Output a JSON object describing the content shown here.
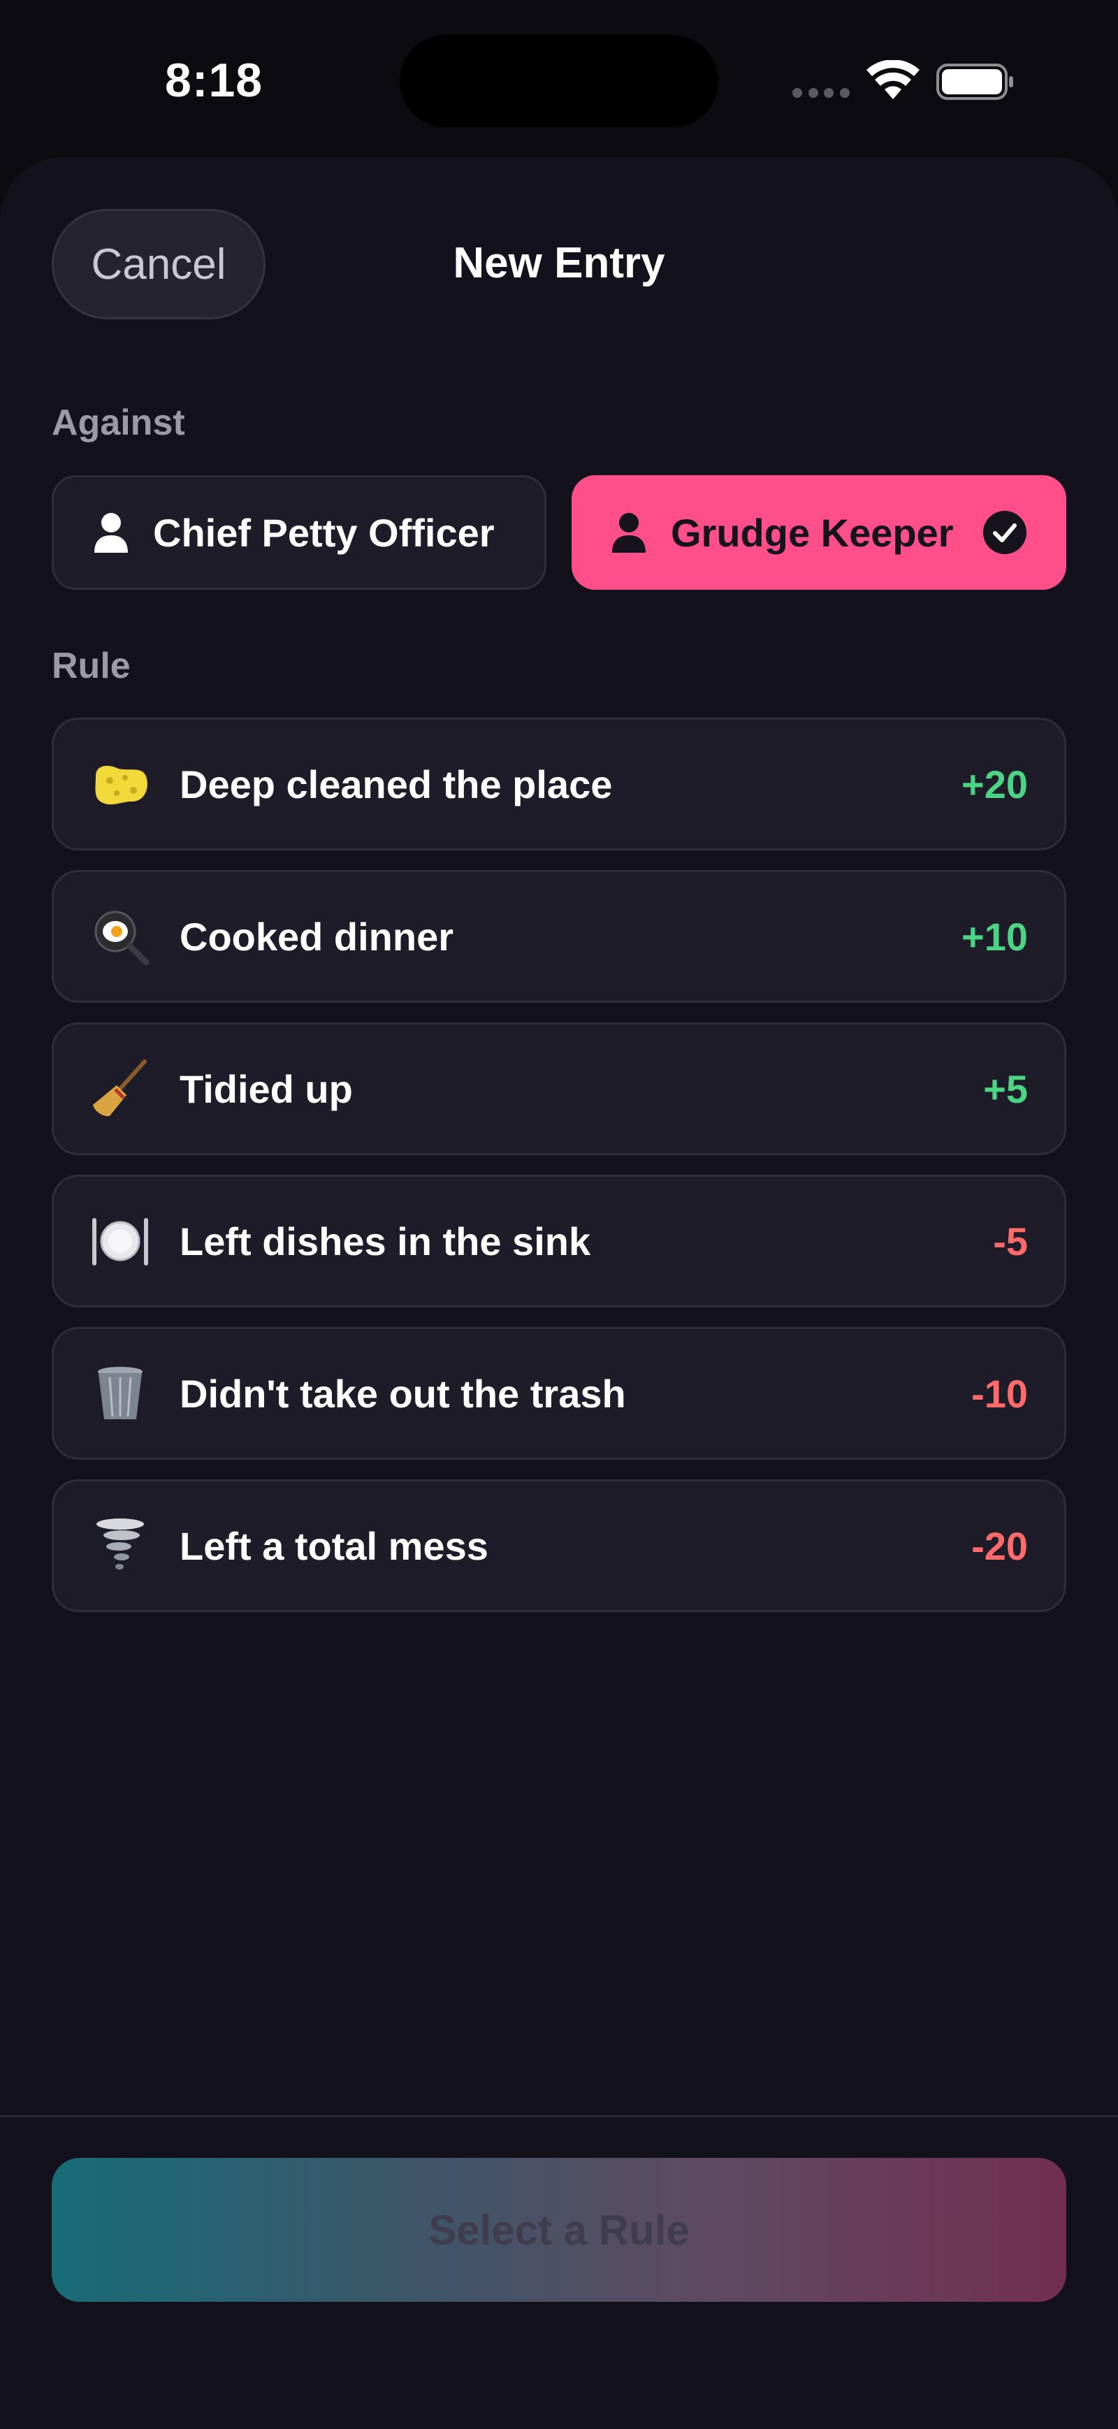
{
  "status_bar": {
    "time": "8:18"
  },
  "header": {
    "cancel_label": "Cancel",
    "title": "New Entry"
  },
  "against": {
    "section_label": "Against",
    "people": [
      {
        "name": "Chief Petty Officer",
        "selected": false
      },
      {
        "name": "Grudge Keeper",
        "selected": true
      }
    ]
  },
  "rules": {
    "section_label": "Rule",
    "items": [
      {
        "icon": "sponge-icon",
        "label": "Deep cleaned the place",
        "points": "+20",
        "sign": "positive"
      },
      {
        "icon": "frying-pan-icon",
        "label": "Cooked dinner",
        "points": "+10",
        "sign": "positive"
      },
      {
        "icon": "broom-icon",
        "label": "Tidied up",
        "points": "+5",
        "sign": "positive"
      },
      {
        "icon": "plate-cutlery-icon",
        "label": "Left dishes in the sink",
        "points": "-5",
        "sign": "negative"
      },
      {
        "icon": "wastebasket-icon",
        "label": "Didn't take out the trash",
        "points": "-10",
        "sign": "negative"
      },
      {
        "icon": "tornado-icon",
        "label": "Left a total mess",
        "points": "-20",
        "sign": "negative"
      }
    ]
  },
  "footer": {
    "button_label": "Select a Rule"
  },
  "colors": {
    "accent_pink": "#ff4f8a",
    "positive": "#4cd383",
    "negative": "#ff6a6a",
    "background": "#13121c"
  }
}
